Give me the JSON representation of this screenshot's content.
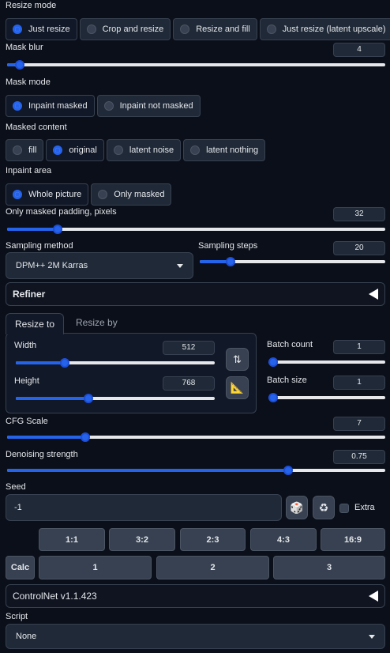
{
  "resize_mode": {
    "label": "Resize mode",
    "options": [
      "Just resize",
      "Crop and resize",
      "Resize and fill",
      "Just resize (latent upscale)"
    ],
    "selected": "Just resize"
  },
  "mask_blur": {
    "label": "Mask blur",
    "value": "4",
    "fraction": 0.022
  },
  "mask_mode": {
    "label": "Mask mode",
    "options": [
      "Inpaint masked",
      "Inpaint not masked"
    ],
    "selected": "Inpaint masked"
  },
  "masked_content": {
    "label": "Masked content",
    "options": [
      "fill",
      "original",
      "latent noise",
      "latent nothing"
    ],
    "selected": "original"
  },
  "inpaint_area": {
    "label": "Inpaint area",
    "options": [
      "Whole picture",
      "Only masked"
    ],
    "selected": "Whole picture"
  },
  "padding": {
    "label": "Only masked padding, pixels",
    "value": "32",
    "fraction": 0.125
  },
  "sampling_method": {
    "label": "Sampling method",
    "value": "DPM++ 2M Karras"
  },
  "sampling_steps": {
    "label": "Sampling steps",
    "value": "20",
    "fraction": 0.15
  },
  "refiner": {
    "label": "Refiner"
  },
  "resize_tabs": {
    "tab1": "Resize to",
    "tab2": "Resize by"
  },
  "width": {
    "label": "Width",
    "value": "512",
    "fraction": 0.235
  },
  "height": {
    "label": "Height",
    "value": "768",
    "fraction": 0.36
  },
  "batch_count": {
    "label": "Batch count",
    "value": "1",
    "fraction": 0.0
  },
  "batch_size": {
    "label": "Batch size",
    "value": "1",
    "fraction": 0.0
  },
  "cfg_scale": {
    "label": "CFG Scale",
    "value": "7",
    "fraction": 0.2
  },
  "denoising": {
    "label": "Denoising strength",
    "value": "0.75",
    "fraction": 0.75
  },
  "seed": {
    "label": "Seed",
    "value": "-1",
    "extra_label": "Extra"
  },
  "aspect_buttons": [
    "1:1",
    "3:2",
    "2:3",
    "4:3",
    "16:9"
  ],
  "calc": {
    "label": "Calc",
    "buttons": [
      "1",
      "2",
      "3"
    ]
  },
  "controlnet": {
    "label": "ControlNet v1.1.423"
  },
  "script": {
    "label": "Script",
    "value": "None"
  },
  "colors": {
    "accent": "#2563eb",
    "background": "#0b0f19",
    "panel": "#1f2937"
  }
}
